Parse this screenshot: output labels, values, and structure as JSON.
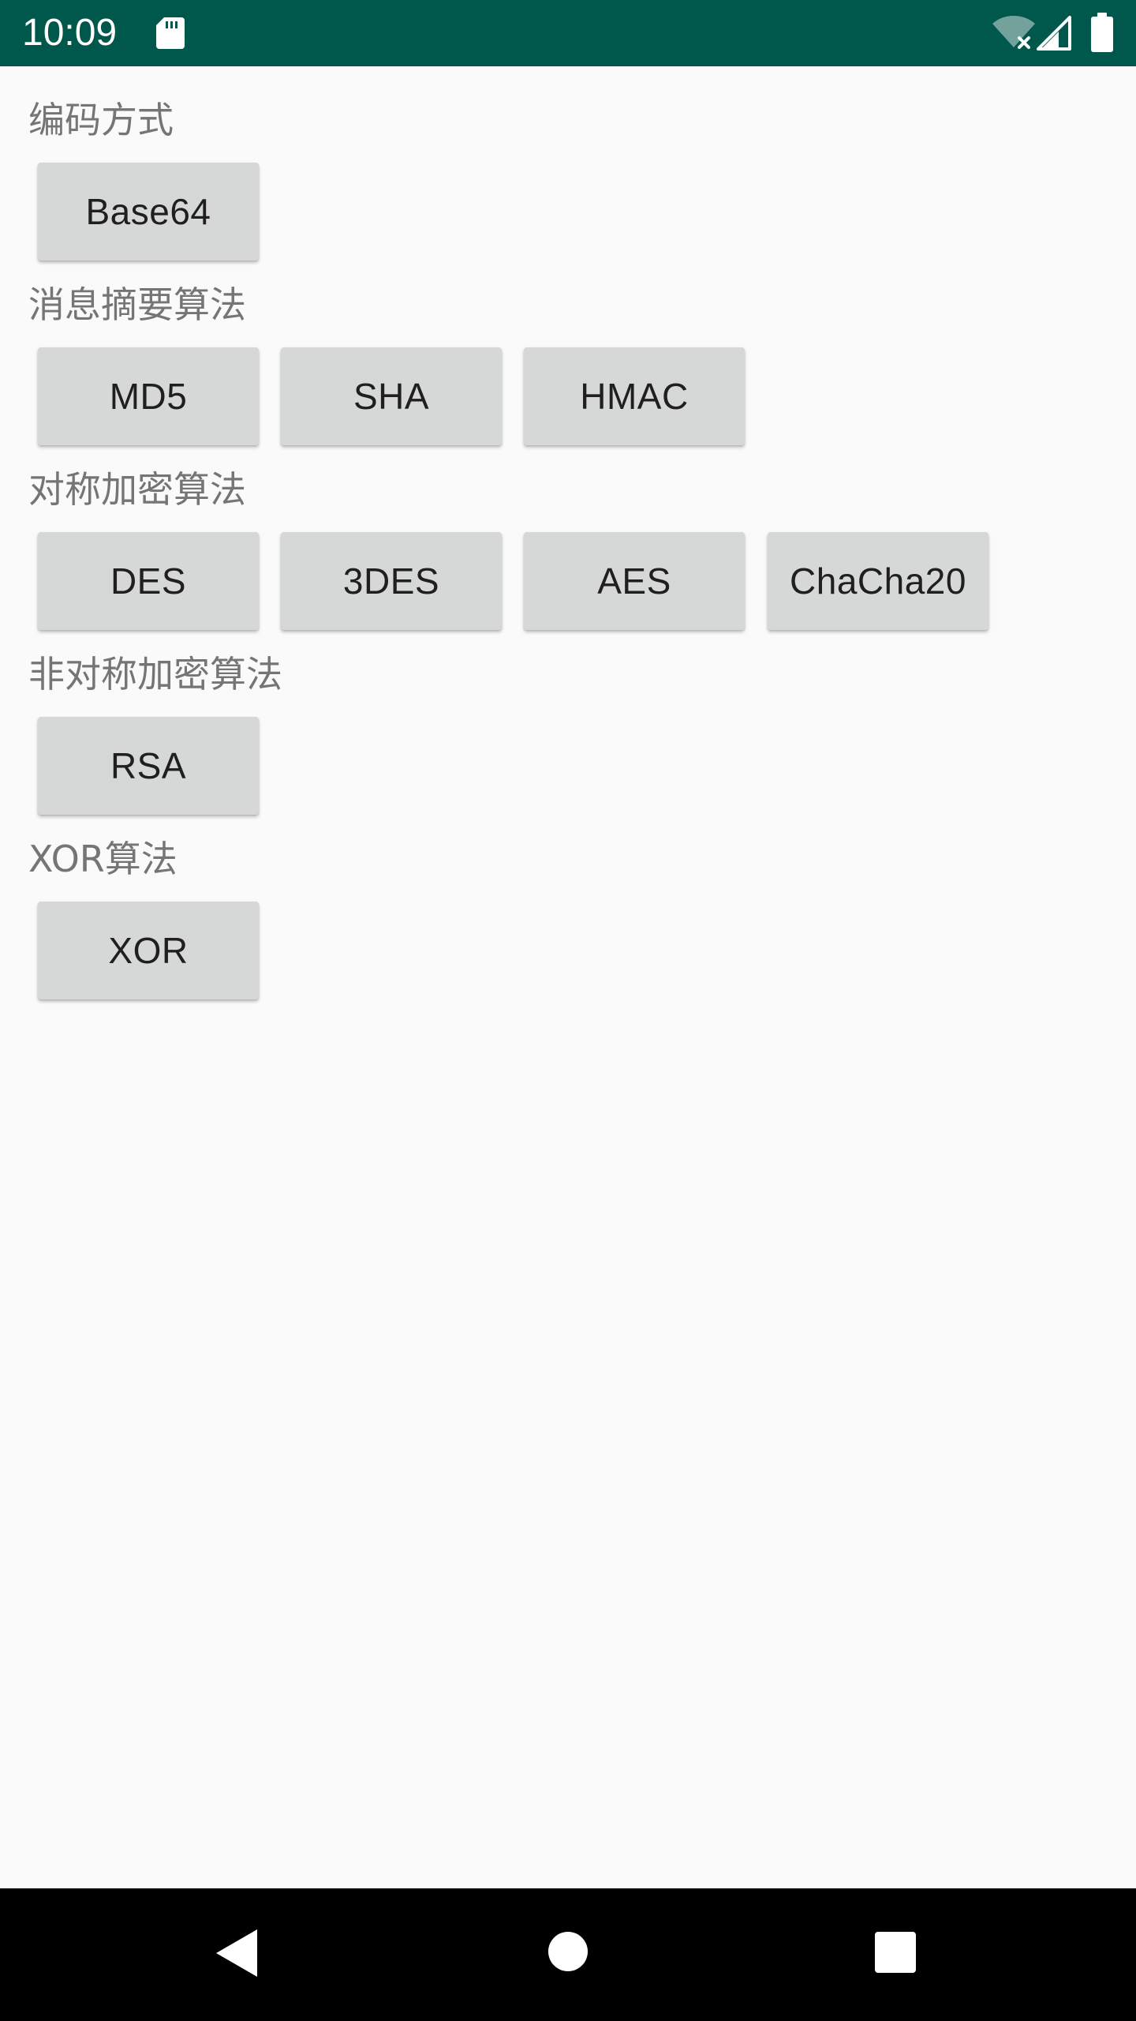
{
  "status_bar": {
    "time": "10:09",
    "icons": [
      "sd-card-icon",
      "wifi-off-icon",
      "signal-icon",
      "battery-icon"
    ],
    "background": "#00574b"
  },
  "sections": [
    {
      "label": "编码方式",
      "buttons": [
        "Base64"
      ]
    },
    {
      "label": "消息摘要算法",
      "buttons": [
        "MD5",
        "SHA",
        "HMAC"
      ]
    },
    {
      "label": "对称加密算法",
      "buttons": [
        "DES",
        "3DES",
        "AES",
        "ChaCha20"
      ]
    },
    {
      "label": "非对称加密算法",
      "buttons": [
        "RSA"
      ]
    },
    {
      "label": "XOR算法",
      "buttons": [
        "XOR"
      ]
    }
  ],
  "nav_bar": {
    "icons": [
      "back-icon",
      "home-icon",
      "recents-icon"
    ]
  },
  "colors": {
    "status_bar": "#00574b",
    "background": "#fafafa",
    "button": "#d6d7d7",
    "label_text": "#757575",
    "button_text": "#1f1f1f"
  }
}
